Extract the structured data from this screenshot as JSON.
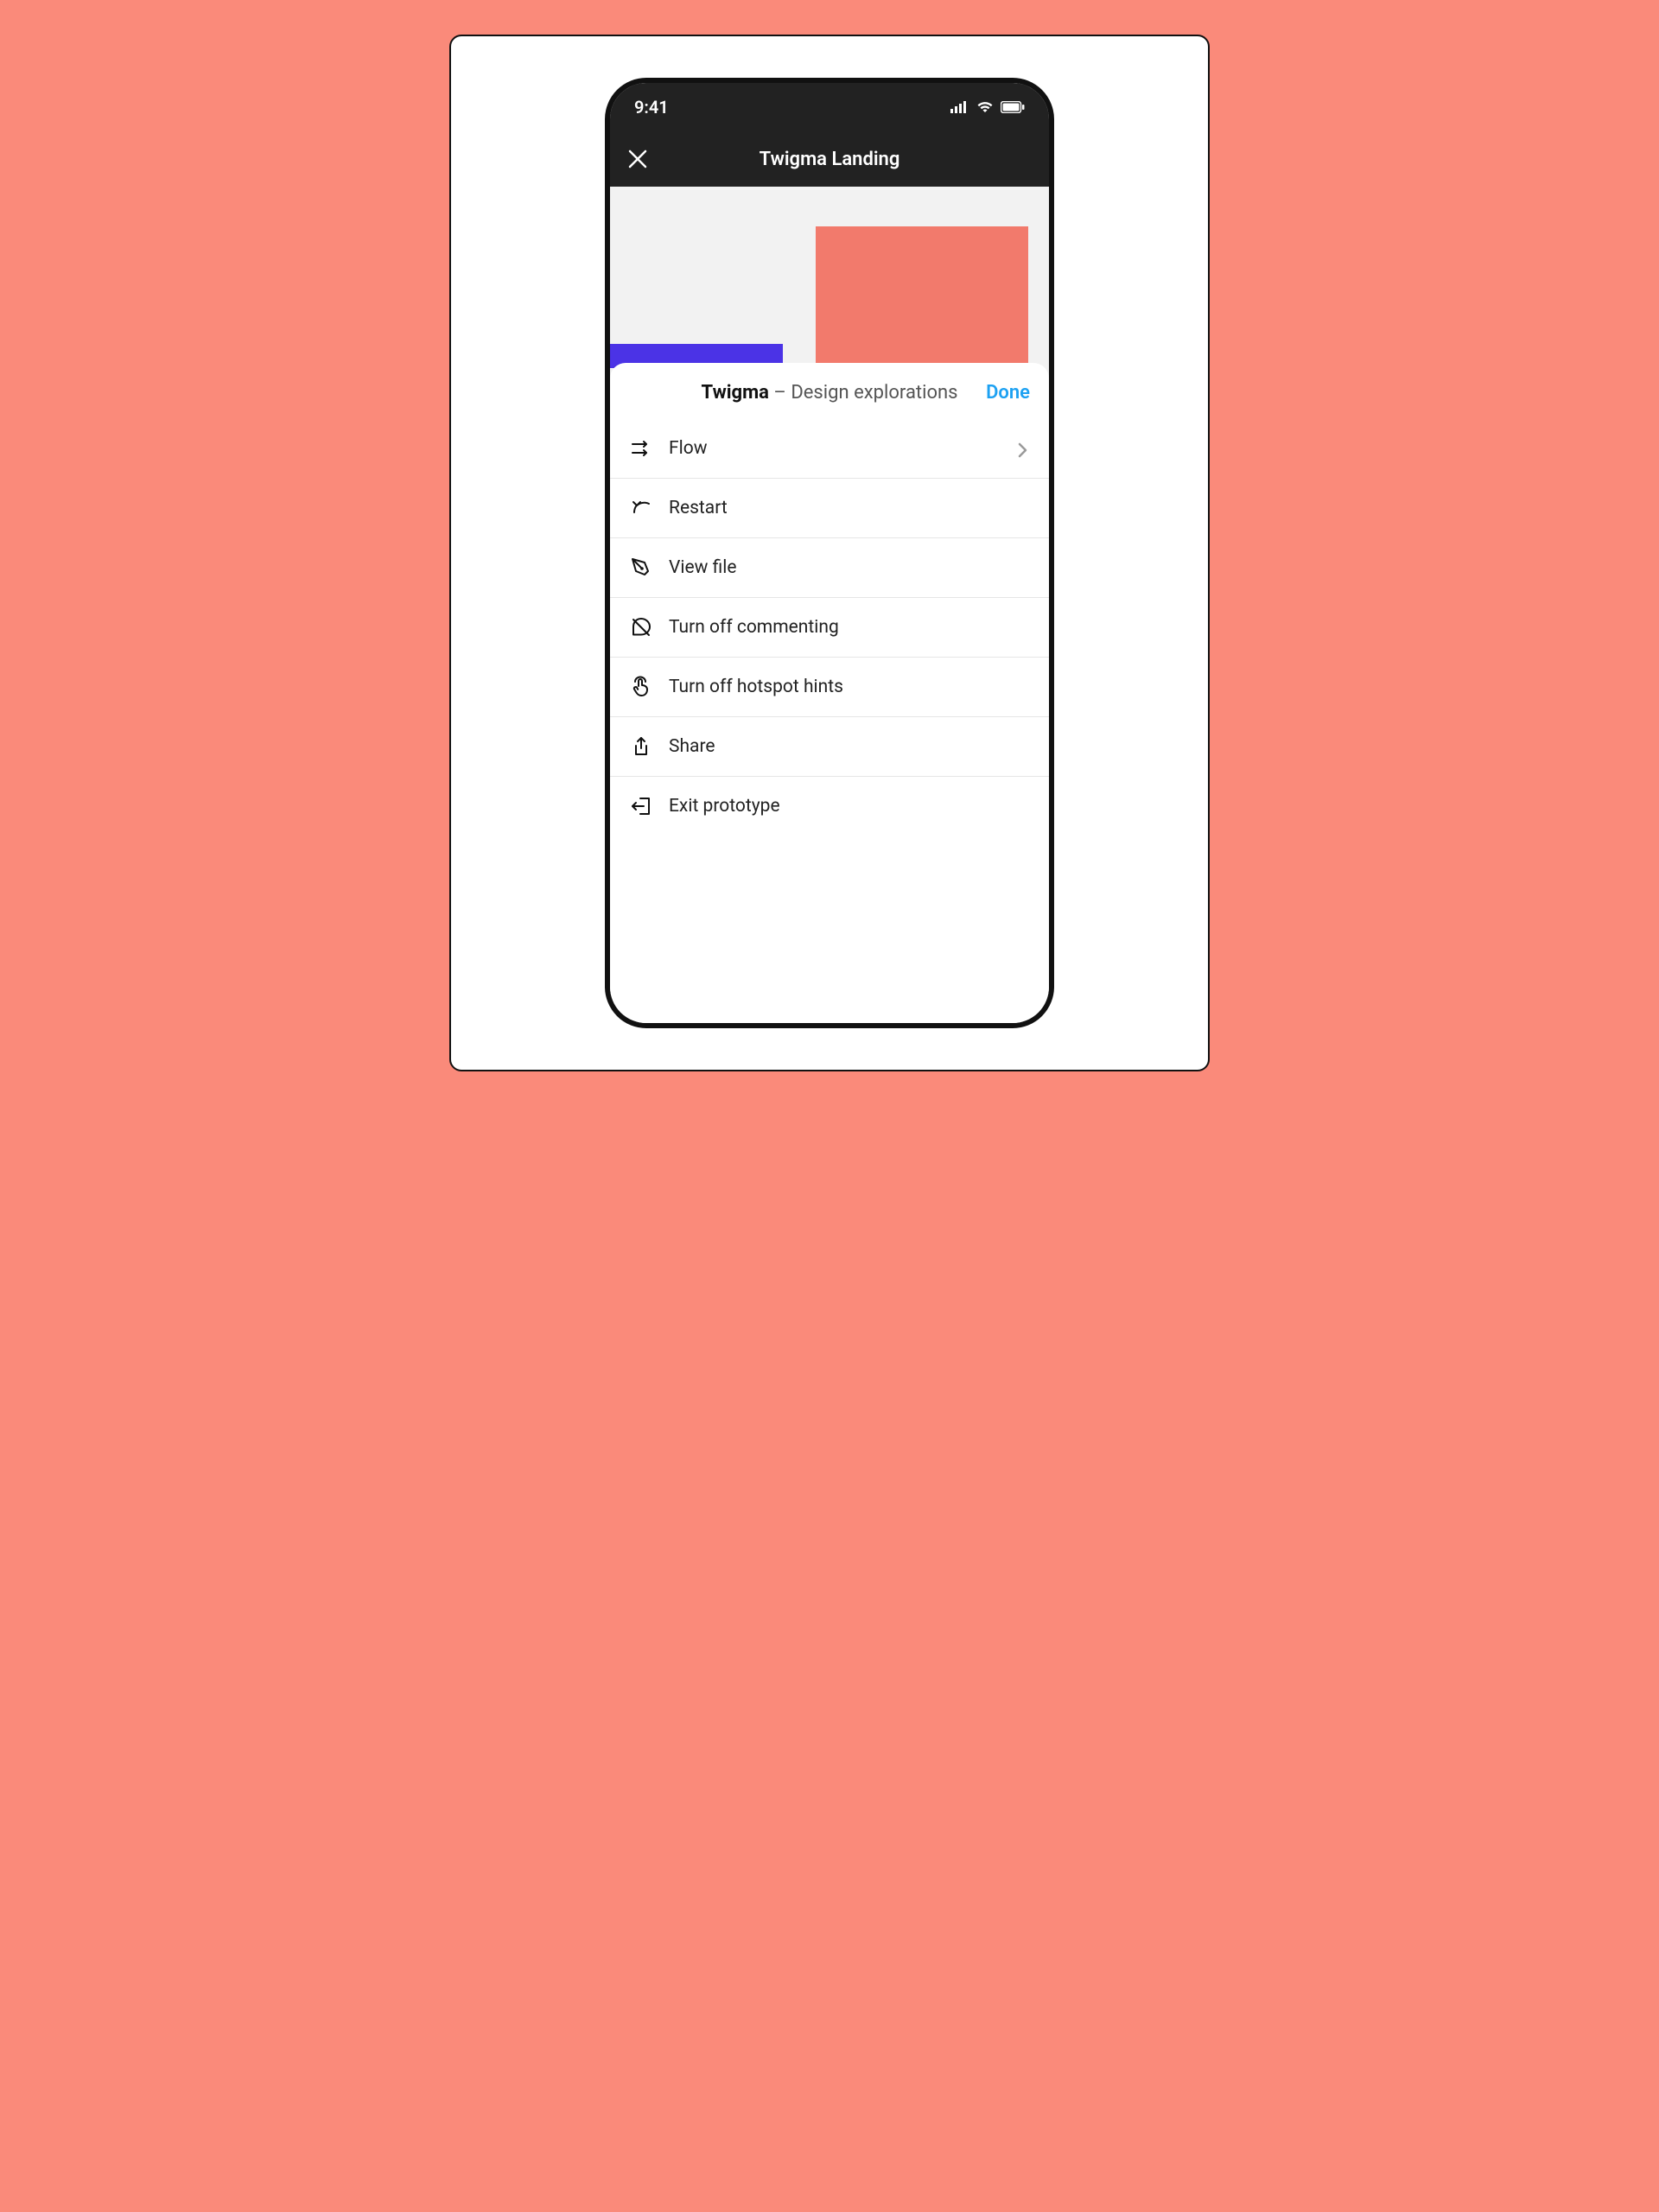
{
  "status": {
    "time": "9:41"
  },
  "nav": {
    "title": "Twigma Landing"
  },
  "sheet": {
    "title_bold": "Twigma",
    "title_rest": " – Design explorations",
    "done_label": "Done"
  },
  "menu": {
    "flow": "Flow",
    "restart": "Restart",
    "viewfile": "View file",
    "comment": "Turn off commenting",
    "hotspot": "Turn off hotspot hints",
    "share": "Share",
    "exit": "Exit prototype"
  }
}
